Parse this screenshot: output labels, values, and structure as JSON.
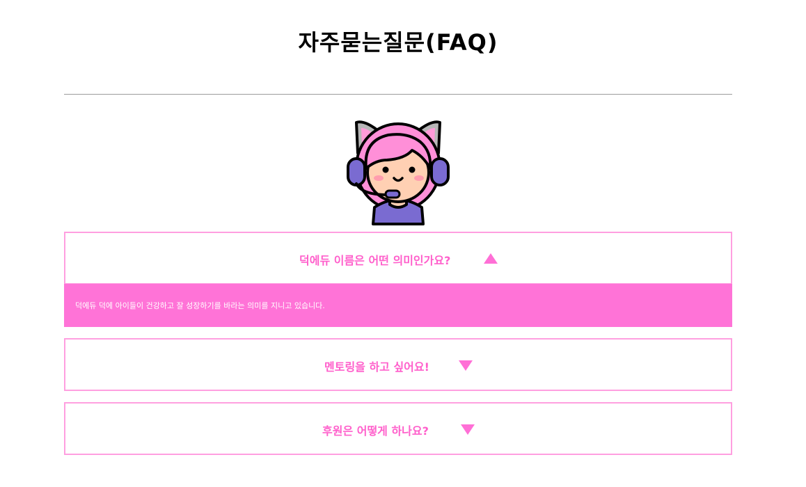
{
  "page": {
    "title": "자주묻는질문(FAQ)"
  },
  "mascot": {
    "icon": "headset-girl-icon",
    "colors": {
      "hair": "#ff8fd8",
      "face": "#ffd0b3",
      "headset": "#7a6bd1",
      "shirt": "#7a6bd1",
      "outline": "#000000"
    }
  },
  "faq": {
    "items": [
      {
        "question": "덕에듀 이름은 어떤 의미인가요?",
        "expanded": true,
        "arrow_icon": "triangle-up-icon",
        "answer": "덕에듀 덕에 아이들이 건강하고 잘 성장하기를 바라는 의미를 지니고 있습니다."
      },
      {
        "question": "멘토링을 하고 싶어요!",
        "expanded": false,
        "arrow_icon": "triangle-down-icon"
      },
      {
        "question": "후원은 어떻게 하나요?",
        "expanded": false,
        "arrow_icon": "triangle-down-icon"
      }
    ]
  },
  "colors": {
    "accent": "#ff5fcb",
    "border": "#ff9fe0",
    "answer_bg": "#ff73d7",
    "divider": "#9a9a9a"
  }
}
